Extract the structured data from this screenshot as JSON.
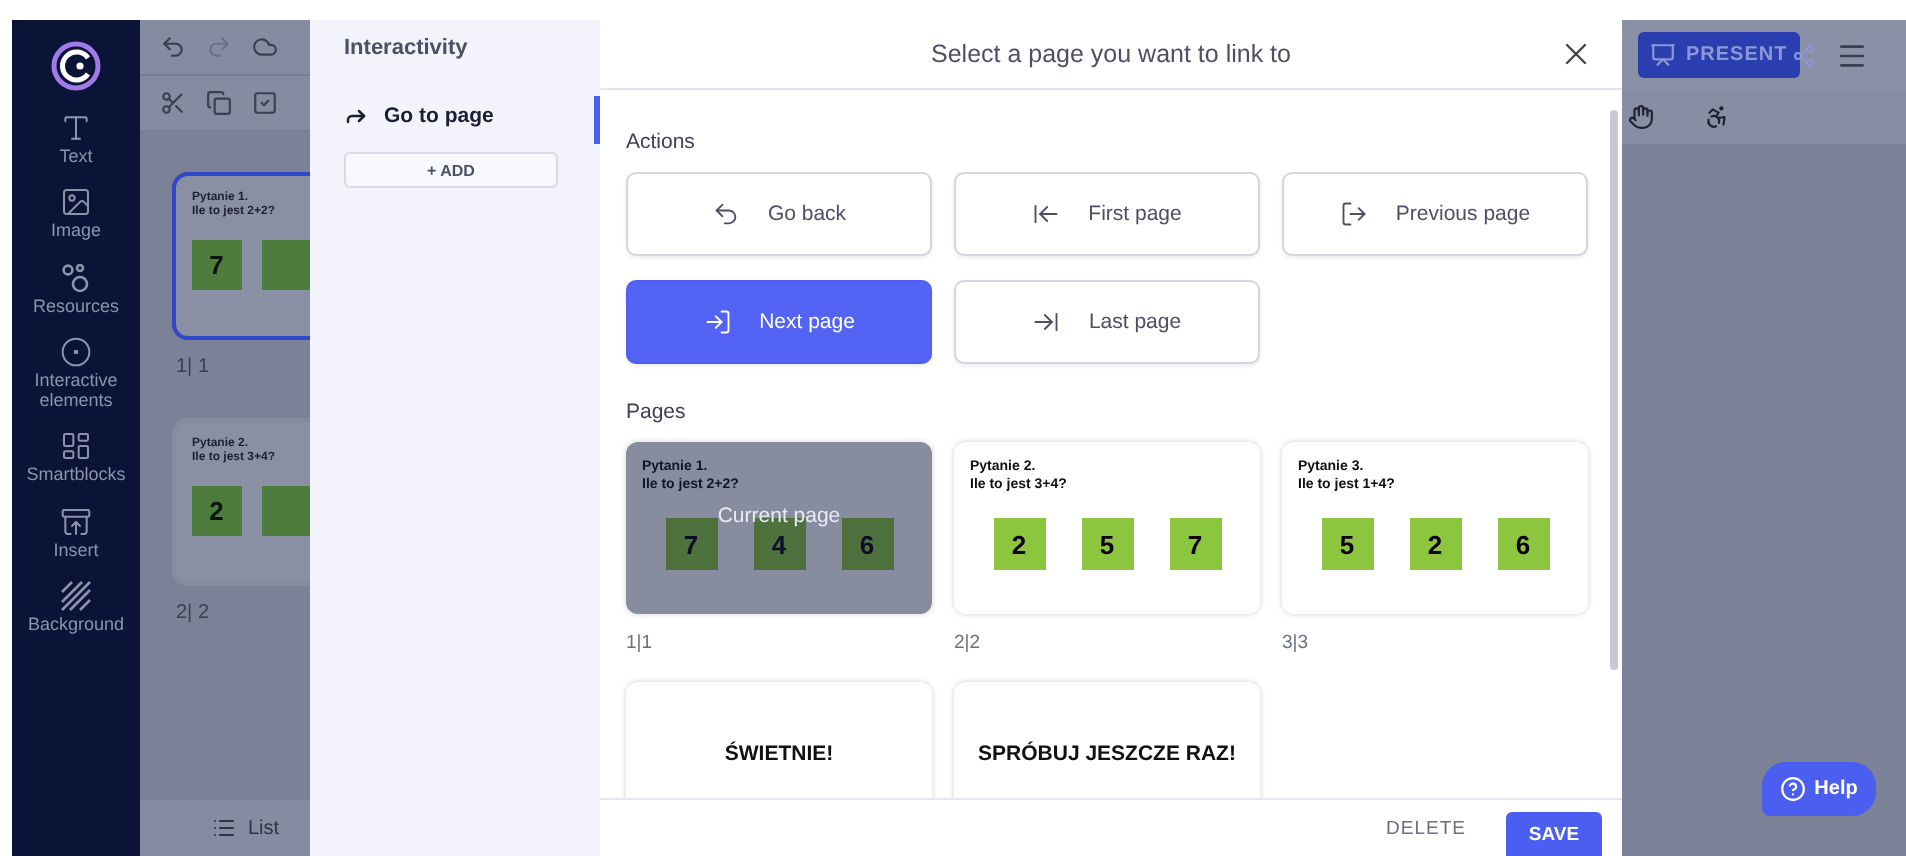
{
  "sidebar": {
    "items": [
      {
        "kind": "text",
        "label": "Text"
      },
      {
        "kind": "image",
        "label": "Image"
      },
      {
        "kind": "resources",
        "label": "Resources"
      },
      {
        "kind": "interactive",
        "label": "Interactive elements"
      },
      {
        "kind": "smartblocks",
        "label": "Smartblocks"
      },
      {
        "kind": "insert",
        "label": "Insert"
      },
      {
        "kind": "background",
        "label": "Background"
      }
    ]
  },
  "editor": {
    "pages": [
      {
        "title": "Pytanie 1.",
        "question": "Ile to jest 2+2?",
        "answers": [
          "7"
        ],
        "number": "1| 1",
        "selected": true
      },
      {
        "title": "Pytanie 2.",
        "question": "Ile to jest 3+4?",
        "answers": [
          "2"
        ],
        "number": "2| 2",
        "selected": false
      }
    ],
    "list_button": "List"
  },
  "interactivity": {
    "title": "Interactivity",
    "actions": [
      {
        "label": "Go to page",
        "selected": true
      }
    ],
    "add_button": "+ ADD"
  },
  "modal": {
    "title": "Select a page you want to link to",
    "actions_label": "Actions",
    "actions": [
      {
        "kind": "back",
        "label": "Go back",
        "selected": false
      },
      {
        "kind": "first",
        "label": "First page",
        "selected": false
      },
      {
        "kind": "previous",
        "label": "Previous page",
        "selected": false
      },
      {
        "kind": "next",
        "label": "Next page",
        "selected": true
      },
      {
        "kind": "last",
        "label": "Last page",
        "selected": false
      }
    ],
    "pages_label": "Pages",
    "pages": [
      {
        "kind": "question",
        "title": "Pytanie 1.",
        "question": "Ile to jest 2+2?",
        "answers": [
          "7",
          "4",
          "6"
        ],
        "current": true,
        "current_label": "Current page",
        "number": "1|1"
      },
      {
        "kind": "question",
        "title": "Pytanie 2.",
        "question": "Ile to jest 3+4?",
        "answers": [
          "2",
          "5",
          "7"
        ],
        "current": false,
        "number": "2|2"
      },
      {
        "kind": "question",
        "title": "Pytanie 3.",
        "question": "Ile to jest 1+4?",
        "answers": [
          "5",
          "2",
          "6"
        ],
        "current": false,
        "number": "3|3"
      },
      {
        "kind": "message",
        "text": "ŚWIETNIE!",
        "current": false
      },
      {
        "kind": "message",
        "text": "SPRÓBUJ JESZCZE RAZ!",
        "current": false
      }
    ],
    "delete_button": "DELETE",
    "save_button": "SAVE"
  },
  "topbar": {
    "present_button": "PRESENT"
  },
  "help_button": "Help"
}
